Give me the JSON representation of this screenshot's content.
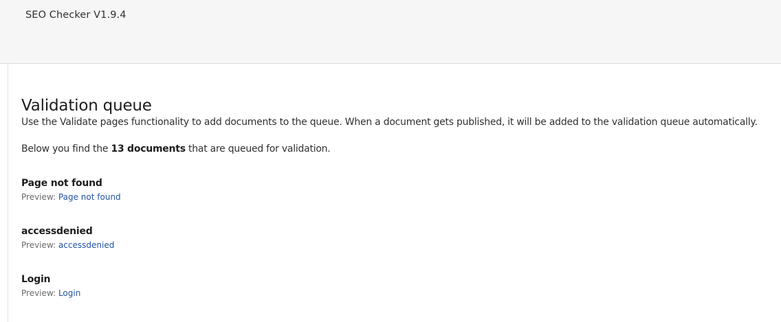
{
  "header": {
    "title": "SEO Checker V1.9.4"
  },
  "main": {
    "title": "Validation queue",
    "intro": "Use the Validate pages functionality to add documents to the queue. When a document gets published, it will be added to the validation queue automatically.",
    "summary_prefix": "Below you find the ",
    "summary_count": "13 documents",
    "summary_suffix": " that are queued for validation.",
    "preview_label": "Preview:",
    "items": [
      {
        "name": "Page not found",
        "link": "Page not found"
      },
      {
        "name": "accessdenied",
        "link": "accessdenied"
      },
      {
        "name": "Login",
        "link": "Login"
      }
    ]
  }
}
